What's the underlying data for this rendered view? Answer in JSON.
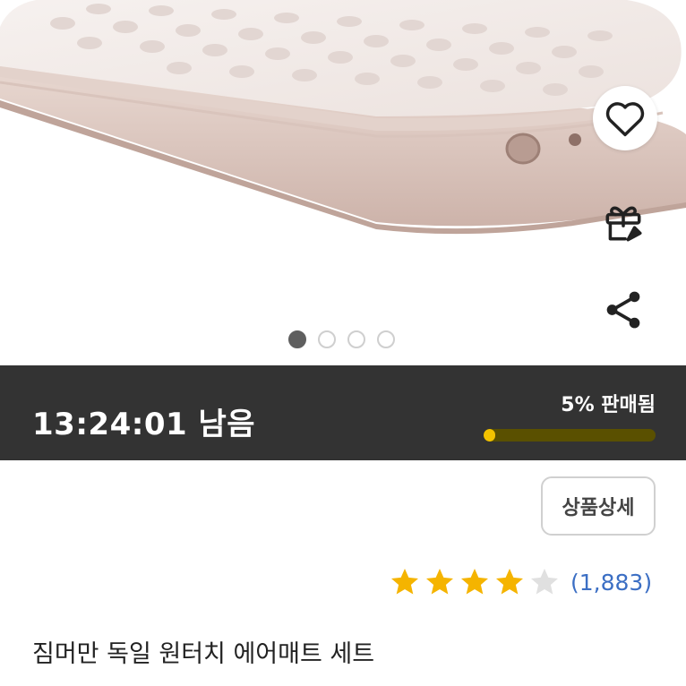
{
  "gallery": {
    "image": "air-mattress-photo",
    "dots": [
      true,
      false,
      false,
      false
    ]
  },
  "actions": {
    "wishlist_icon": "heart-icon",
    "gift_icon": "gift-icon",
    "share_icon": "share-icon"
  },
  "deal": {
    "remaining": "13:24:01 남음",
    "sold_label": "5% 판매됨",
    "sold_percent": 5,
    "colors": {
      "bar_bg": "#333333",
      "progress": "#f2c200"
    }
  },
  "product": {
    "detail_button": "상품상세",
    "rating": 4,
    "rating_max": 5,
    "review_count": "(1,883)",
    "title": "짐머만 독일 원터치 에어매트 세트",
    "colors": {
      "star_on": "#f5b400",
      "star_off": "#e0e0e0",
      "review_link": "#3c6fc4"
    }
  }
}
